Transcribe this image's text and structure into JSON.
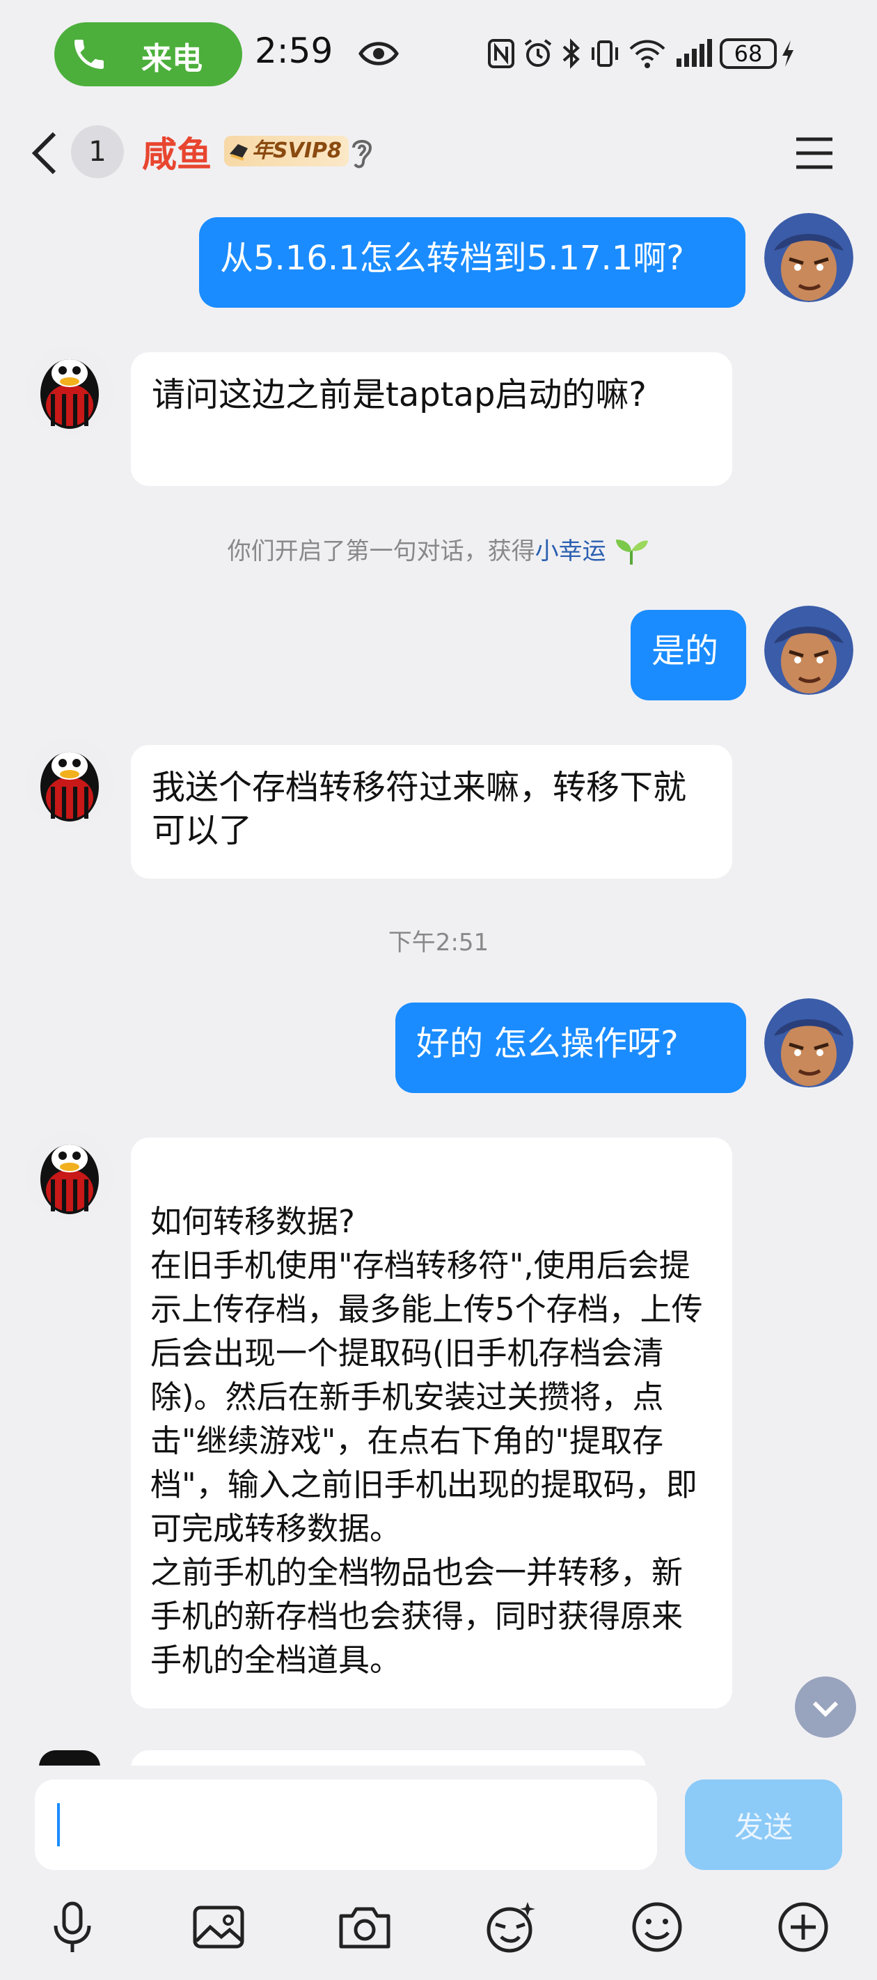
{
  "status_bar": {
    "call_label": "来电",
    "time": "2:59",
    "battery": "68"
  },
  "header": {
    "unread_count": "1",
    "chat_name": "咸鱼",
    "vip_badge": "年SVIP8"
  },
  "messages": [
    {
      "side": "out",
      "text": "从5.16.1怎么转档到5.17.1啊?"
    },
    {
      "side": "in",
      "text": "请问这边之前是taptap启动的嘛?"
    },
    {
      "side": "out",
      "text": "是的"
    },
    {
      "side": "in",
      "text": "我送个存档转移符过来嘛，转移下就可以了"
    },
    {
      "side": "out",
      "text": "好的 怎么操作呀?"
    },
    {
      "side": "in",
      "text": "如何转移数据?\n在旧手机使用\"存档转移符\",使用后会提示上传存档，最多能上传5个存档，上传后会出现一个提取码(旧手机存档会清除)。然后在新手机安装过关攒将，点击\"继续游戏\"，在点右下角的\"提取存档\"，输入之前旧手机出现的提取码，即可完成转移数据。\n之前手机的全档物品也会一并转移，新手机的新存档也会获得，同时获得原来手机的全档道具。"
    }
  ],
  "system_notice": {
    "prefix": "你们开启了第一句对话，获得",
    "link": "小幸运"
  },
  "timestamp": "下午2:51",
  "input": {
    "value": "",
    "send_label": "发送"
  },
  "toolbar_icons": [
    "microphone-icon",
    "image-icon",
    "camera-icon",
    "magic-face-icon",
    "emoji-icon",
    "plus-icon"
  ],
  "colors": {
    "accent_blue": "#1a8cff",
    "name_red": "#e8452f",
    "call_green": "#4caf3b"
  }
}
